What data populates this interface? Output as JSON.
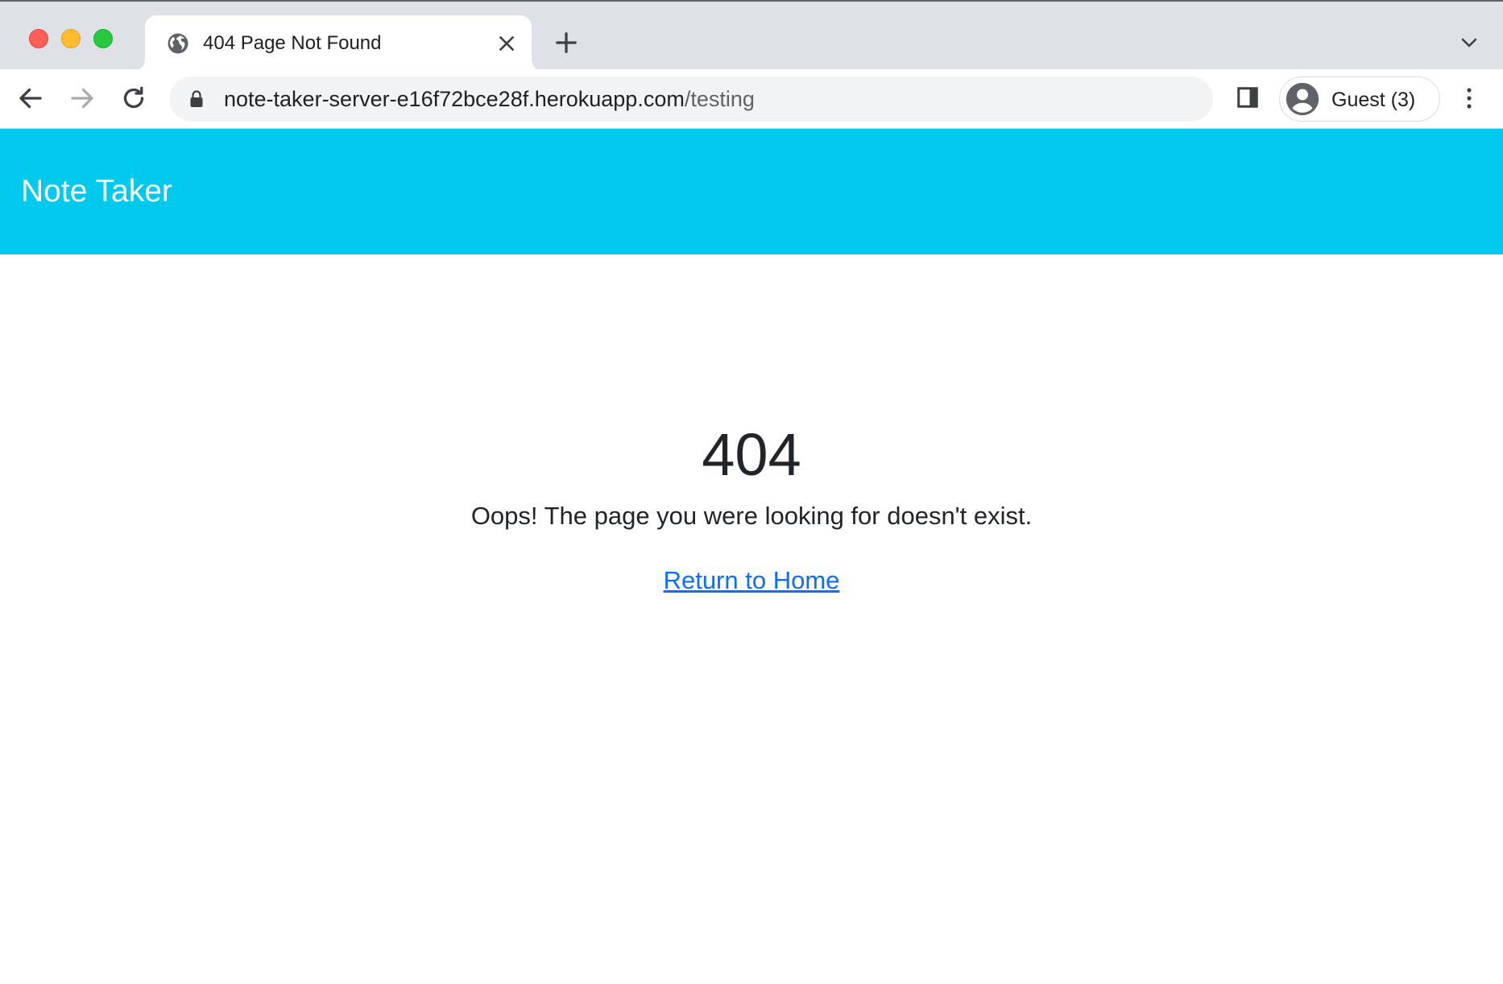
{
  "browser": {
    "tab": {
      "title": "404 Page Not Found",
      "favicon": "globe-icon"
    },
    "address_bar": {
      "host": "note-taker-server-e16f72bce28f.herokuapp.com",
      "path": "/testing"
    },
    "profile": {
      "label": "Guest (3)",
      "icon": "account-circle-icon"
    },
    "colors": {
      "tabstrip": "#dee1e6",
      "omnibox": "#f1f3f4"
    }
  },
  "page": {
    "navbar": {
      "brand": "Note Taker",
      "color": "#00c9ee"
    },
    "error": {
      "code": "404",
      "message": "Oops! The page you were looking for doesn't exist.",
      "link_label": "Return to Home",
      "link_color": "#0d6efd"
    }
  }
}
